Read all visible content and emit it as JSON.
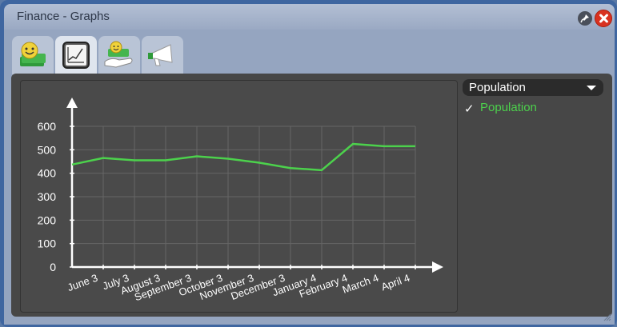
{
  "window": {
    "title": "Finance - Graphs"
  },
  "tabs": [
    {
      "name": "tab-finance-overview",
      "icon": "smiley-money-icon"
    },
    {
      "name": "tab-graphs",
      "icon": "graph-icon",
      "active": true
    },
    {
      "name": "tab-budget",
      "icon": "hand-money-icon"
    },
    {
      "name": "tab-advertising",
      "icon": "megaphone-icon"
    }
  ],
  "selector": {
    "selected": "Population"
  },
  "series_list": [
    {
      "label": "Population",
      "checked": true,
      "color": "#4cd14c"
    }
  ],
  "chart_data": {
    "type": "line",
    "title": "",
    "xlabel": "",
    "ylabel": "",
    "categories": [
      "June 3",
      "July 3",
      "August 3",
      "September 3",
      "October 3",
      "November 3",
      "December 3",
      "January 4",
      "February 4",
      "March 4",
      "April 4"
    ],
    "series": [
      {
        "name": "Population",
        "color": "#4cd14c",
        "x": [
          0,
          1,
          2,
          3,
          4,
          5,
          6,
          7,
          8,
          9,
          10,
          11
        ],
        "values": [
          437,
          465,
          455,
          455,
          472,
          462,
          445,
          422,
          413,
          525,
          515,
          515
        ]
      }
    ],
    "yticks": [
      0,
      100,
      200,
      300,
      400,
      500,
      600
    ],
    "ylim": [
      0,
      600
    ],
    "grid": true
  }
}
